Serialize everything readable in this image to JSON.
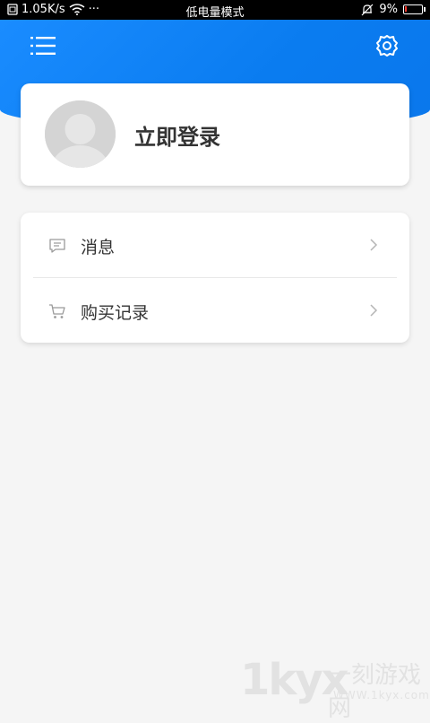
{
  "status_bar": {
    "speed": "1.05K/s",
    "dots": "···",
    "mode": "低电量模式",
    "battery": "9%",
    "battery_level": 0.09,
    "battery_color": "#ff3b30"
  },
  "header": {
    "menu_icon": "menu-icon",
    "settings_icon": "gear-icon",
    "accent": "#0a7cf0"
  },
  "profile": {
    "login_label": "立即登录"
  },
  "menu": {
    "items": [
      {
        "label": "消息",
        "icon": "message-icon"
      },
      {
        "label": "购买记录",
        "icon": "cart-icon"
      }
    ]
  },
  "watermark": {
    "logo": "1kyx",
    "text": "一刻游戏网",
    "url": "WWW.1kyx.com"
  }
}
